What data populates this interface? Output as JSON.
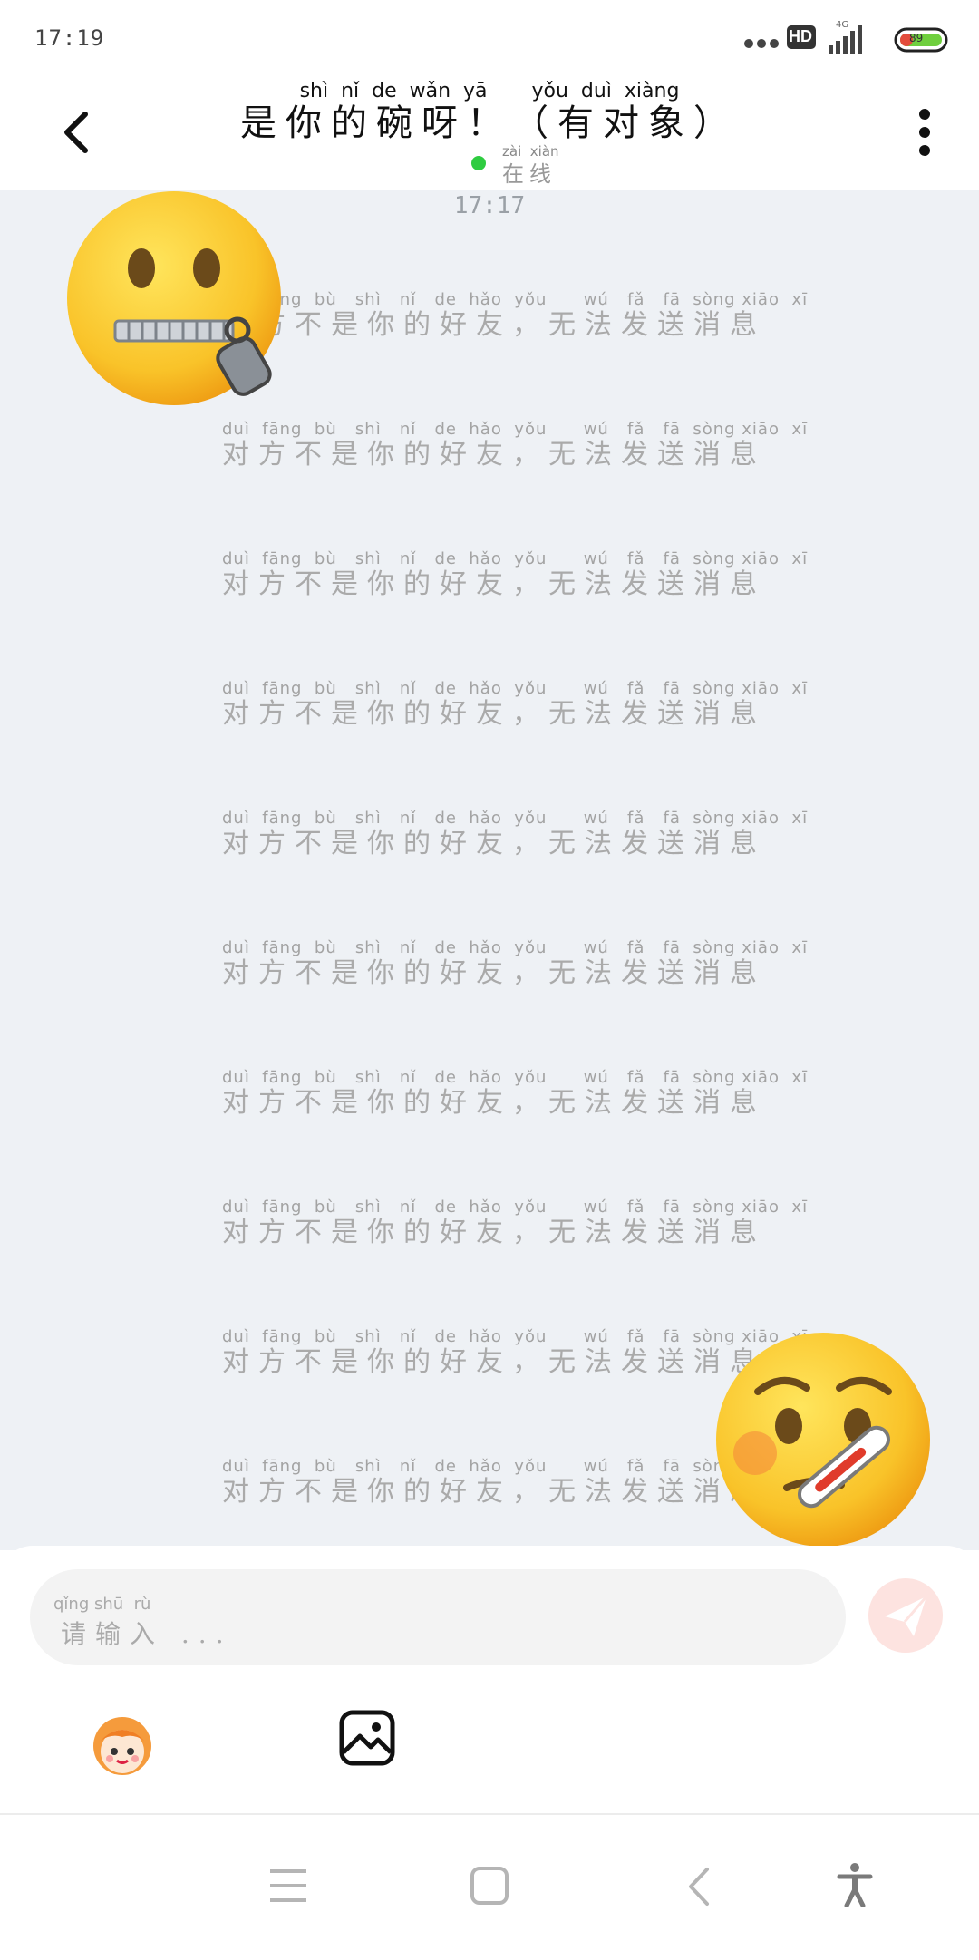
{
  "status_bar": {
    "time": "17:19",
    "hd_label": "HD",
    "network_label": "4G",
    "battery": "89"
  },
  "header": {
    "title_pinyin": "shì  nǐ  de  wǎn  yā       yǒu  duì  xiàng",
    "title": "是你的碗呀！（有对象）",
    "status_pinyin": "zài  xiàn",
    "status": "在线",
    "status_color": "#2ecc40"
  },
  "chat": {
    "timestamp": "17:17",
    "notices": [
      {
        "pinyin": "duì  fāng  bù   shì   nǐ   de  hǎo  yǒu      wú   fǎ   fā  sòng xiāo  xī",
        "text": "对方不是你的好友，无法发送消息"
      },
      {
        "pinyin": "duì  fāng  bù   shì   nǐ   de  hǎo  yǒu      wú   fǎ   fā  sòng xiāo  xī",
        "text": "对方不是你的好友，无法发送消息"
      },
      {
        "pinyin": "duì  fāng  bù   shì   nǐ   de  hǎo  yǒu      wú   fǎ   fā  sòng xiāo  xī",
        "text": "对方不是你的好友，无法发送消息"
      },
      {
        "pinyin": "duì  fāng  bù   shì   nǐ   de  hǎo  yǒu      wú   fǎ   fā  sòng xiāo  xī",
        "text": "对方不是你的好友，无法发送消息"
      },
      {
        "pinyin": "duì  fāng  bù   shì   nǐ   de  hǎo  yǒu      wú   fǎ   fā  sòng xiāo  xī",
        "text": "对方不是你的好友，无法发送消息"
      },
      {
        "pinyin": "duì  fāng  bù   shì   nǐ   de  hǎo  yǒu      wú   fǎ   fā  sòng xiāo  xī",
        "text": "对方不是你的好友，无法发送消息"
      },
      {
        "pinyin": "duì  fāng  bù   shì   nǐ   de  hǎo  yǒu      wú   fǎ   fā  sòng xiāo  xī",
        "text": "对方不是你的好友，无法发送消息"
      },
      {
        "pinyin": "duì  fāng  bù   shì   nǐ   de  hǎo  yǒu      wú   fǎ   fā  sòng xiāo  xī",
        "text": "对方不是你的好友，无法发送消息"
      },
      {
        "pinyin": "duì  fāng  bù   shì   nǐ   de  hǎo  yǒu      wú   fǎ   fā  sòng xiāo  xī",
        "text": "对方不是你的好友，无法发送消息"
      },
      {
        "pinyin": "duì  fāng  bù   shì   nǐ   de  hǎo  yǒu      wú   fǎ   fā  sòng xiāo  xī",
        "text": "对方不是你的好友，无法发送消息"
      }
    ],
    "stickers": [
      "zipper-mouth-face",
      "face-with-thermometer"
    ]
  },
  "composer": {
    "placeholder_pinyin": "qǐng shū  rù",
    "placeholder": "请输入 ...",
    "send_color": "#fde3e0",
    "tools": [
      "sticker-avatar-icon",
      "image-icon"
    ]
  },
  "nav_bar": {
    "buttons": [
      "menu-icon",
      "home-square-icon",
      "back-chevron-icon",
      "accessibility-icon"
    ]
  }
}
